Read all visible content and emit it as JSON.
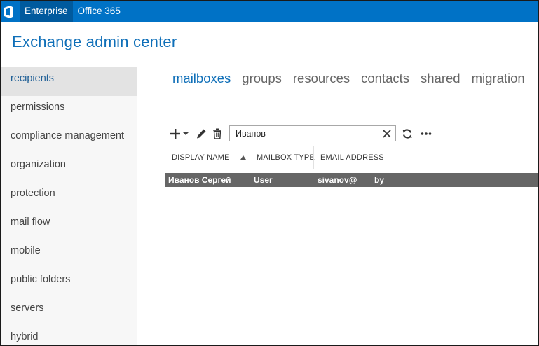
{
  "topbar": {
    "nav": [
      {
        "label": "Enterprise",
        "active": true
      },
      {
        "label": "Office 365",
        "active": false
      }
    ],
    "color": "#0072c6"
  },
  "app": {
    "title": "Exchange admin center"
  },
  "sidebar": {
    "items": [
      {
        "label": "recipients",
        "active": true
      },
      {
        "label": "permissions"
      },
      {
        "label": "compliance management"
      },
      {
        "label": "organization"
      },
      {
        "label": "protection"
      },
      {
        "label": "mail flow"
      },
      {
        "label": "mobile"
      },
      {
        "label": "public folders"
      },
      {
        "label": "servers"
      },
      {
        "label": "hybrid"
      }
    ]
  },
  "tabs": [
    {
      "label": "mailboxes",
      "active": true
    },
    {
      "label": "groups"
    },
    {
      "label": "resources"
    },
    {
      "label": "contacts"
    },
    {
      "label": "shared"
    },
    {
      "label": "migration"
    }
  ],
  "toolbar": {
    "icons": [
      "plus-icon",
      "chevron-down-icon",
      "pencil-icon",
      "trash-icon",
      "refresh-icon",
      "more-icon"
    ],
    "search": {
      "value": "Иванов"
    }
  },
  "table": {
    "columns": [
      "DISPLAY NAME",
      "MAILBOX TYPE",
      "EMAIL ADDRESS"
    ],
    "sort": {
      "column": "DISPLAY NAME",
      "direction": "ascending"
    },
    "rows": [
      {
        "display_name": "Иванов Сергей",
        "mailbox_type": "User",
        "email_local": "sivanov@",
        "email_domain": "by",
        "selected": true
      }
    ]
  },
  "colors": {
    "accent": "#0f6fb8",
    "selected_row": "#666666",
    "sidebar_bg": "#f7f7f7",
    "sidebar_active": "#e3e3e3"
  }
}
